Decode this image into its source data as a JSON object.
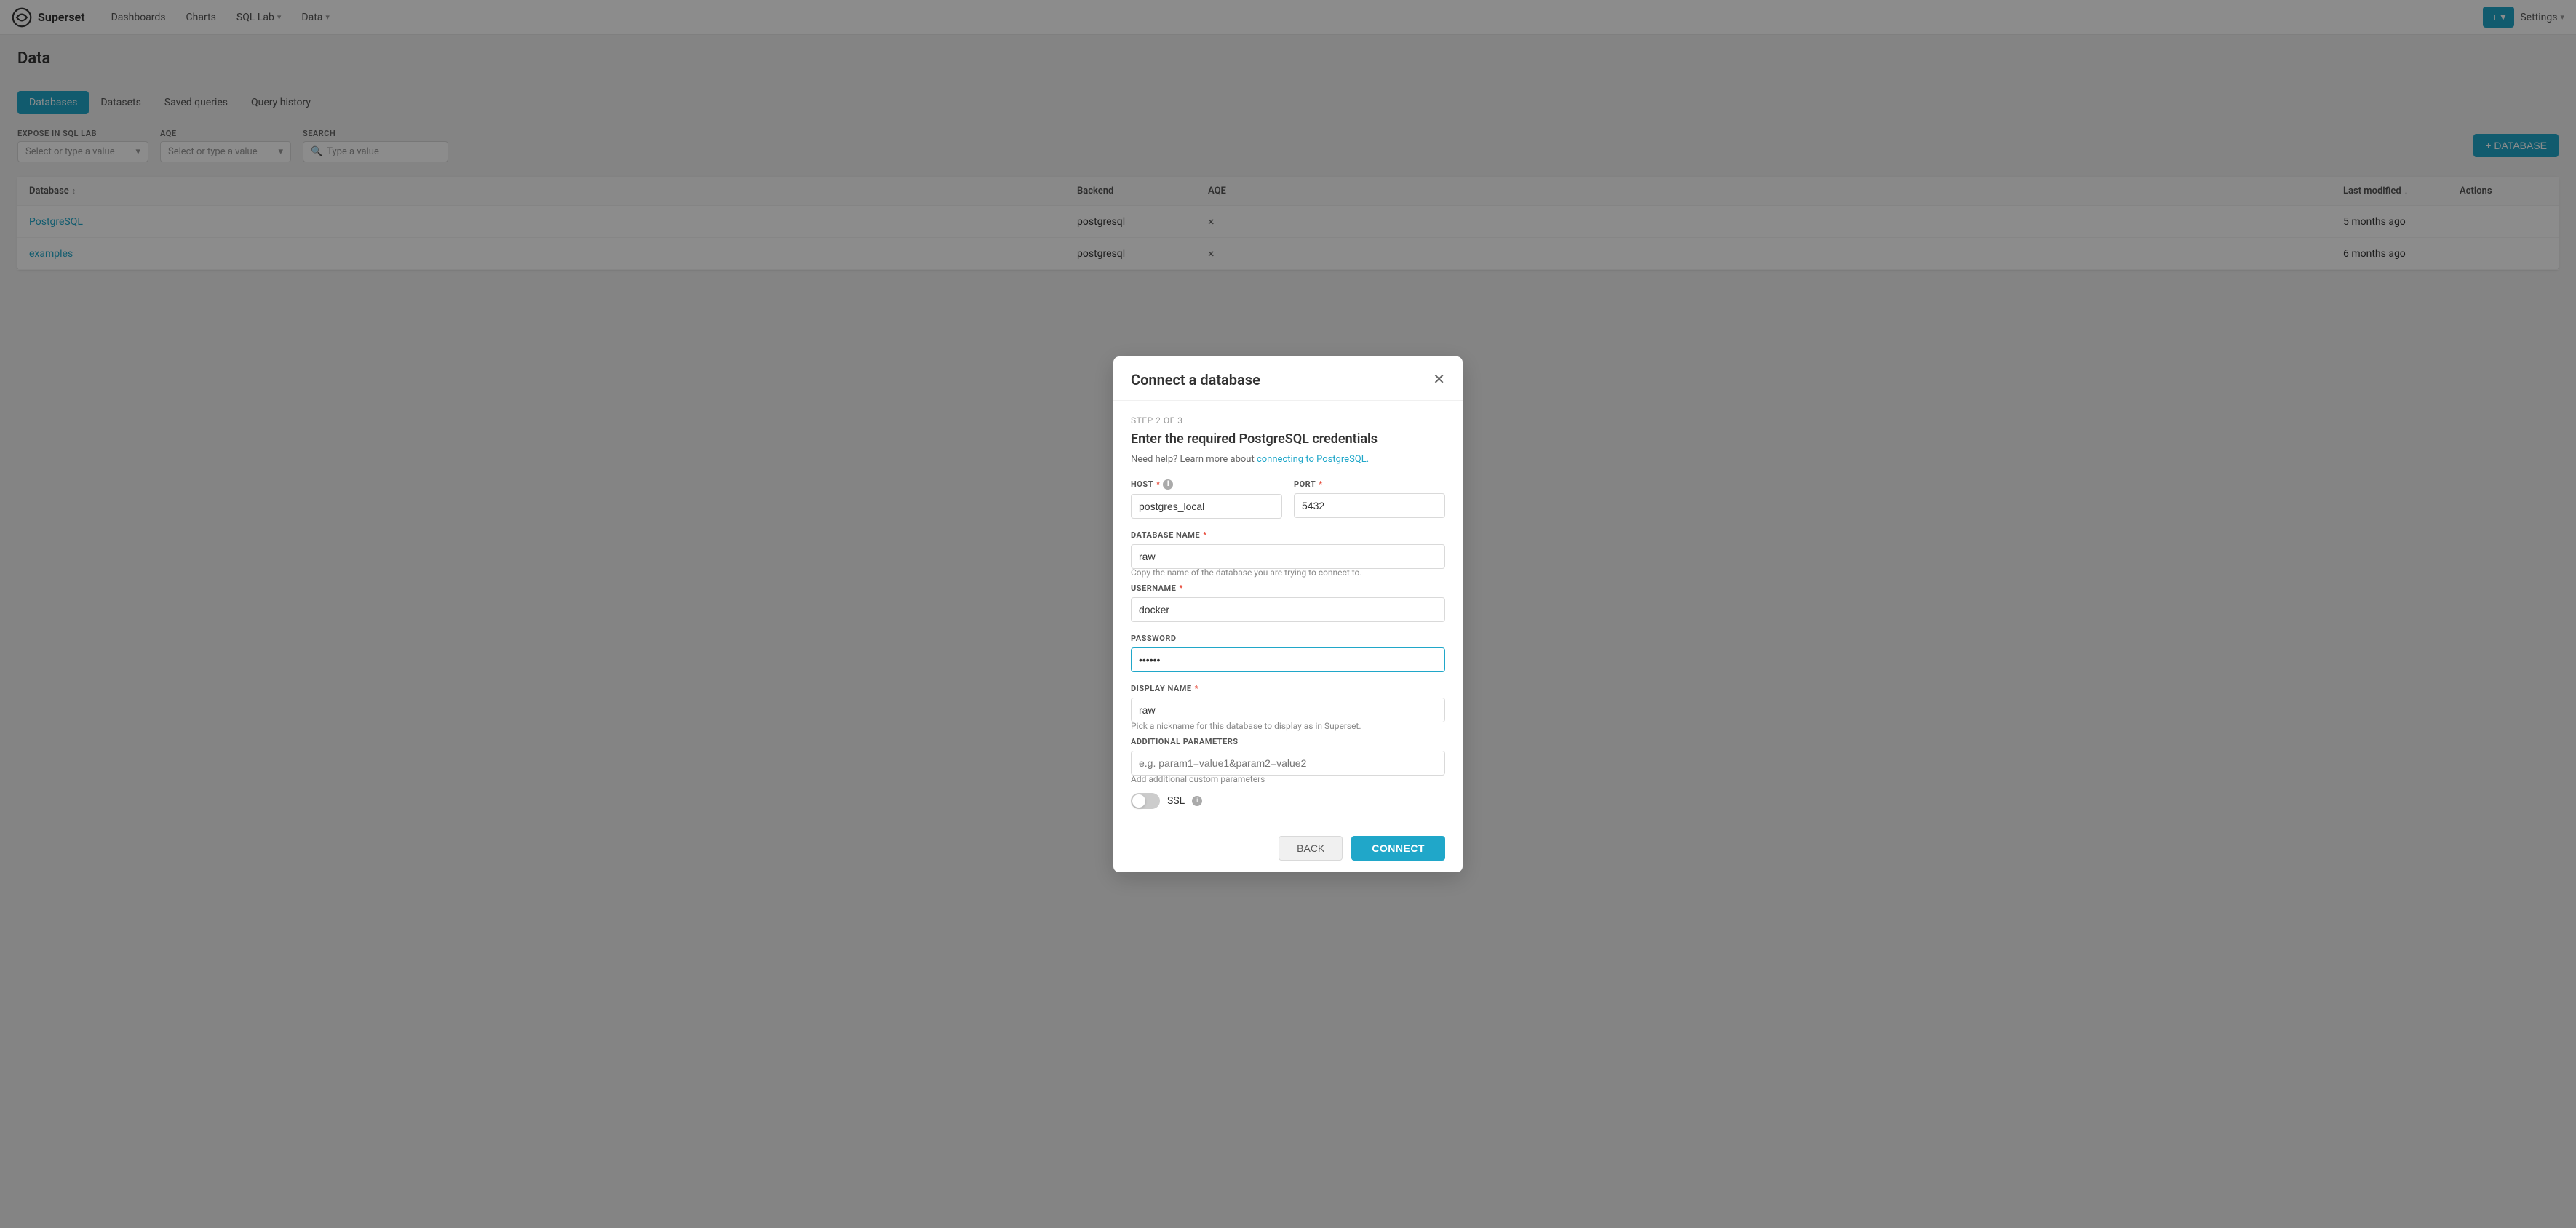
{
  "app": {
    "name": "Superset"
  },
  "nav": {
    "dashboards": "Dashboards",
    "charts": "Charts",
    "sql_lab": "SQL Lab",
    "data": "Data",
    "settings": "Settings",
    "plus_btn": "+ ▾"
  },
  "page": {
    "title": "Data",
    "add_btn": "+ DATABASE"
  },
  "tabs": [
    {
      "id": "databases",
      "label": "Databases",
      "active": true
    },
    {
      "id": "datasets",
      "label": "Datasets",
      "active": false
    },
    {
      "id": "saved_queries",
      "label": "Saved queries",
      "active": false
    },
    {
      "id": "query_history",
      "label": "Query history",
      "active": false
    }
  ],
  "filters": {
    "expose_label": "EXPOSE IN SQL LAB",
    "expose_placeholder": "Select or type a value",
    "aqe_label": "AQE",
    "aqe_placeholder": "Select or type a value",
    "search_label": "SEARCH",
    "search_placeholder": "Type a value"
  },
  "table": {
    "columns": [
      {
        "id": "database",
        "label": "Database",
        "sortable": true
      },
      {
        "id": "backend",
        "label": "Backend",
        "sortable": false
      },
      {
        "id": "aqe",
        "label": "AQE",
        "sortable": false
      },
      {
        "id": "spacer",
        "label": "",
        "sortable": false
      },
      {
        "id": "last_modified",
        "label": "Last modified",
        "sortable": true
      },
      {
        "id": "actions",
        "label": "Actions",
        "sortable": false
      }
    ],
    "rows": [
      {
        "database": "PostgreSQL",
        "backend": "postgresql",
        "aqe": "×",
        "spacer": "",
        "last_modified": "5 months ago",
        "actions": ""
      },
      {
        "database": "examples",
        "backend": "postgresql",
        "aqe": "×",
        "spacer": "",
        "last_modified": "6 months ago",
        "actions": ""
      }
    ]
  },
  "modal": {
    "title": "Connect a database",
    "step_label": "STEP 2 OF 3",
    "subtitle": "Enter the required PostgreSQL credentials",
    "help_text": "Need help? Learn more about ",
    "help_link_text": "connecting to PostgreSQL.",
    "fields": {
      "host_label": "HOST",
      "host_value": "postgres_local",
      "port_label": "PORT",
      "port_value": "5432",
      "db_name_label": "DATABASE NAME",
      "db_name_value": "raw",
      "db_name_help": "Copy the name of the database you are trying to connect to.",
      "username_label": "USERNAME",
      "username_value": "docker",
      "password_label": "PASSWORD",
      "password_value": "docker",
      "display_name_label": "DISPLAY NAME",
      "display_name_value": "raw",
      "display_name_help": "Pick a nickname for this database to display as in Superset.",
      "additional_params_label": "ADDITIONAL PARAMETERS",
      "additional_params_placeholder": "e.g. param1=value1&param2=value2",
      "additional_params_help": "Add additional custom parameters",
      "ssl_label": "SSL"
    },
    "back_btn": "BACK",
    "connect_btn": "CONNECT"
  }
}
